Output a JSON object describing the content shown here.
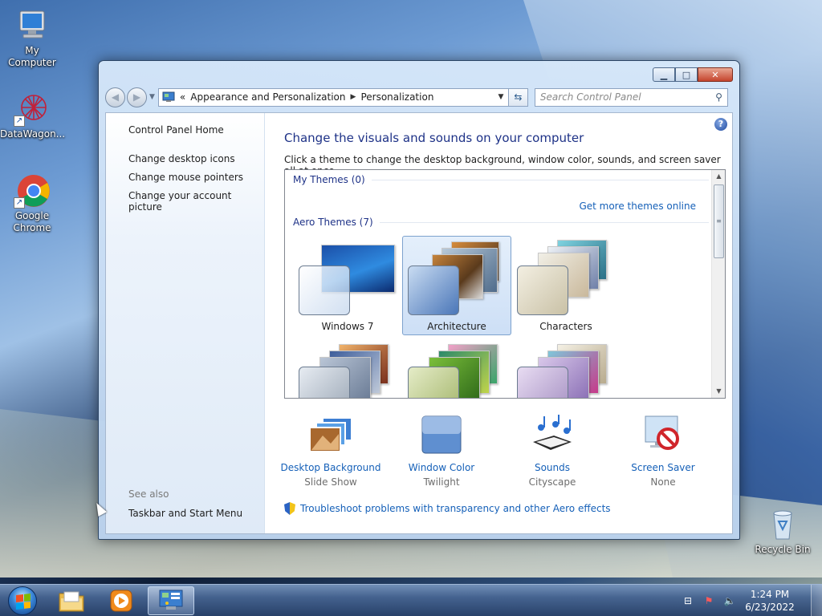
{
  "desktop": {
    "icons": [
      {
        "label": "My Computer"
      },
      {
        "label": "DataWagon..."
      },
      {
        "label": "Google Chrome"
      },
      {
        "label": "Recycle Bin"
      }
    ]
  },
  "window": {
    "address": {
      "prefix": "«",
      "crumbs": [
        "Appearance and Personalization",
        "Personalization"
      ]
    },
    "search_placeholder": "Search Control Panel",
    "left_nav": {
      "home": "Control Panel Home",
      "links": [
        "Change desktop icons",
        "Change mouse pointers",
        "Change your account picture"
      ],
      "see_also": "See also",
      "see_also_links": [
        "Taskbar and Start Menu"
      ]
    },
    "main": {
      "title": "Change the visuals and sounds on your computer",
      "subtitle": "Click a theme to change the desktop background, window color, sounds, and screen saver all at once.",
      "my_themes": "My Themes (0)",
      "get_more": "Get more themes online",
      "aero_themes": "Aero Themes (7)",
      "themes": [
        {
          "label": "Windows 7",
          "selected": false
        },
        {
          "label": "Architecture",
          "selected": true
        },
        {
          "label": "Characters",
          "selected": false
        },
        {
          "label": "",
          "selected": false
        },
        {
          "label": "",
          "selected": false
        },
        {
          "label": "",
          "selected": false
        }
      ],
      "settings": [
        {
          "name": "Desktop Background",
          "value": "Slide Show"
        },
        {
          "name": "Window Color",
          "value": "Twilight"
        },
        {
          "name": "Sounds",
          "value": "Cityscape"
        },
        {
          "name": "Screen Saver",
          "value": "None"
        }
      ],
      "troubleshoot": "Troubleshoot problems with transparency and other Aero effects"
    }
  },
  "taskbar": {
    "time": "1:24 PM",
    "date": "6/23/2022"
  },
  "colors": {
    "link_blue": "#1560b8",
    "heading_blue": "#1e3287",
    "selection_border": "#7da2ce"
  }
}
